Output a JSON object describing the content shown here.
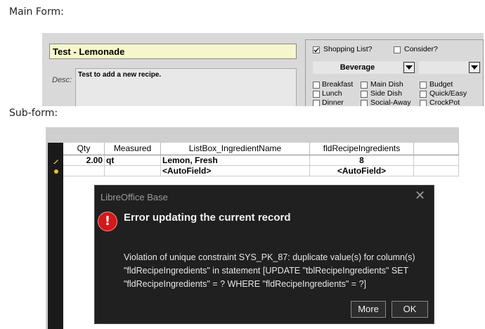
{
  "main_form": {
    "caption": "Main Form:",
    "recipe_name": "Test - Lemonade",
    "desc_label": "Desc:",
    "description": "Test to add a new recipe.",
    "shopping_list": {
      "label": "Shopping List?",
      "checked": true
    },
    "consider": {
      "label": "Consider?",
      "checked": false
    },
    "category_value": "Beverage",
    "second_combo_value": "",
    "meal_types": [
      {
        "label": "Breakfast",
        "checked": false
      },
      {
        "label": "Lunch",
        "checked": false
      },
      {
        "label": "Dinner",
        "checked": false
      },
      {
        "label": "Main Dish",
        "checked": false
      },
      {
        "label": "Side Dish",
        "checked": false
      },
      {
        "label": "Social-Away",
        "checked": false
      },
      {
        "label": "Budget",
        "checked": false
      },
      {
        "label": "Quick/Easy",
        "checked": false
      },
      {
        "label": "CrockPot",
        "checked": false
      }
    ]
  },
  "sub_form": {
    "caption": "Sub-form:",
    "columns": [
      "Qty",
      "Measured",
      "ListBox_IngredientName",
      "fldRecipeIngredients"
    ],
    "rows": [
      {
        "qty": "2.00",
        "measured": "qt",
        "ingredient": "Lemon, Fresh",
        "id": "8"
      },
      {
        "qty": "",
        "measured": "",
        "ingredient": "<AutoField>",
        "id": "<AutoField>"
      }
    ]
  },
  "dialog": {
    "title": "LibreOffice Base",
    "close_glyph": "✕",
    "icon_glyph": "!",
    "heading": "Error updating the current record",
    "message": "Violation of unique constraint SYS_PK_87: duplicate value(s) for column(s) \"fldRecipeIngredients\" in statement [UPDATE \"tblRecipeIngredients\" SET \"fldRecipeIngredients\" = ? WHERE \"fldRecipeIngredients\" = ?]",
    "more_label": "More",
    "ok_label": "OK"
  },
  "colors": {
    "dialog_bg": "#202020",
    "error_red": "#d11a1a",
    "title_field_bg": "#f6f6cc"
  },
  "icons": {
    "edit_row": "pencil-icon",
    "new_row": "new-record-dot-icon"
  }
}
